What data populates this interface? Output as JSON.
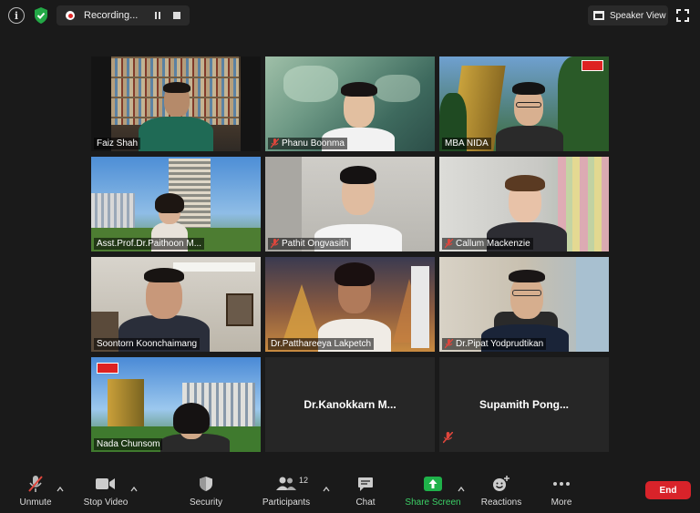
{
  "top_bar": {
    "recording_label": "Recording...",
    "view_label": "Speaker View"
  },
  "participants": [
    {
      "name": "Faiz Shah",
      "muted": false
    },
    {
      "name": "Phanu Boonma",
      "muted": true
    },
    {
      "name": "MBA NIDA",
      "muted": false
    },
    {
      "name": "Asst.Prof.Dr.Paithoon M...",
      "muted": false
    },
    {
      "name": "Pathit Ongvasith",
      "muted": true
    },
    {
      "name": "Callum Mackenzie",
      "muted": true
    },
    {
      "name": "Soontorn Koonchaimang",
      "muted": false
    },
    {
      "name": "Dr.Patthareeya Lakpetch",
      "muted": false,
      "active_speaker": true
    },
    {
      "name": "Dr.Pipat Yodprudtikan",
      "muted": true
    },
    {
      "name": "Nada Chunsom",
      "muted": false
    },
    {
      "name": "Dr.Kanokkarn M...",
      "muted": false,
      "video_off": true
    },
    {
      "name": "Supamith Pong...",
      "muted": true,
      "video_off": true
    }
  ],
  "toolbar": {
    "unmute_label": "Unmute",
    "stop_video_label": "Stop Video",
    "security_label": "Security",
    "participants_label": "Participants",
    "participants_count": "12",
    "chat_label": "Chat",
    "share_screen_label": "Share Screen",
    "reactions_label": "Reactions",
    "more_label": "More",
    "end_label": "End"
  },
  "colors": {
    "active_speaker_border": "#c8de3c",
    "share_screen_green": "#1fb24a",
    "end_red": "#d8232a",
    "muted_red": "#e0463c",
    "background": "#1a1a1a"
  }
}
